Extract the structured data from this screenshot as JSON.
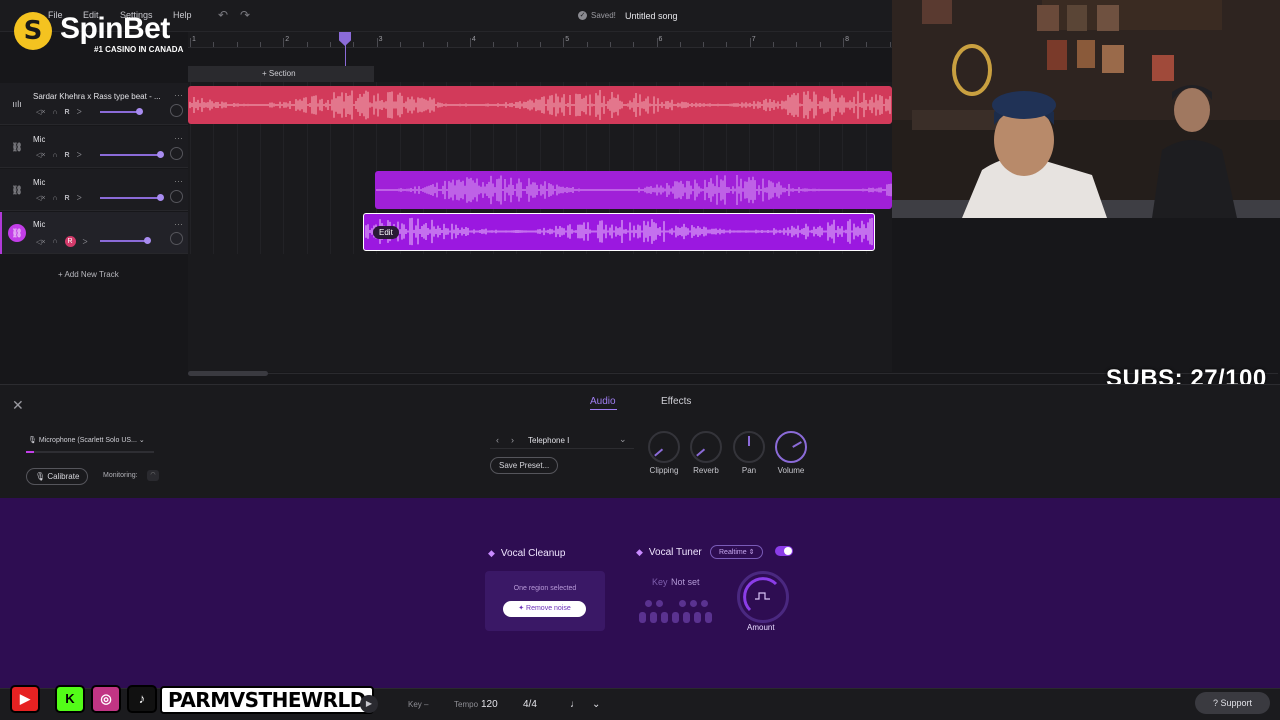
{
  "logo": {
    "name": "SpinBet",
    "tagline": "#1 CASINO IN CANADA",
    "glyph": "S"
  },
  "menu": [
    "File",
    "Edit",
    "Settings",
    "Help"
  ],
  "header": {
    "saved": "Saved!",
    "song_title": "Untitled song",
    "undo_icon": "undo-icon",
    "redo_icon": "redo-icon"
  },
  "ruler": {
    "numbers": [
      "1",
      "2",
      "3",
      "4",
      "5",
      "6",
      "7",
      "8"
    ]
  },
  "section": {
    "label": "+ Section"
  },
  "tracks": [
    {
      "name": "Sardar Khehra x Rass type beat - ...",
      "icon": "waveform-icon",
      "controls": [
        "◁×",
        "∩",
        "R",
        "ᐳ"
      ],
      "volume": 0.6,
      "color": "#d23a5a"
    },
    {
      "name": "Mic",
      "icon": "link-icon",
      "controls": [
        "◁×",
        "∩",
        "R",
        "ᐳ"
      ],
      "volume": 0.9
    },
    {
      "name": "Mic",
      "icon": "link-icon",
      "controls": [
        "◁×",
        "∩",
        "R",
        "ᐳ"
      ],
      "volume": 0.9,
      "color": "#a020d8"
    },
    {
      "name": "Mic",
      "icon": "link-icon",
      "controls": [
        "◁×",
        "∩",
        "R",
        "ᐳ"
      ],
      "volume": 0.75,
      "color": "#9b18e0",
      "selected": true
    }
  ],
  "clip": {
    "edit_label": "Edit"
  },
  "add_track": "+ Add New Track",
  "overlay": {
    "subs": "SUBS: 27/100"
  },
  "panel": {
    "close_icon": "close-icon",
    "tabs": [
      "Audio",
      "Effects"
    ],
    "active_tab": "Audio",
    "mic": "Microphone (Scarlett Solo US...",
    "calibrate": "Calibrate",
    "monitoring": "Monitoring:",
    "preset": "Telephone I",
    "save_preset": "Save Preset...",
    "effects": [
      "Clipping",
      "Reverb",
      "Pan",
      "Volume"
    ]
  },
  "vocal_cleanup": {
    "title": "Vocal Cleanup",
    "status": "One region selected",
    "button": "Remove noise"
  },
  "vocal_tuner": {
    "title": "Vocal Tuner",
    "mode": "Realtime",
    "key_label": "Key",
    "key_value": "Not set",
    "amount": "Amount",
    "enabled": true
  },
  "bottom": {
    "handle": "PARMVSTHEWRLD",
    "key_label": "Key",
    "key_value": "–",
    "tempo_label": "Tempo",
    "tempo_value": "120",
    "time_sig": "4/4",
    "support": "Support"
  },
  "colors": {
    "accent": "#8b6bd8",
    "beat_clip": "#d23a5a",
    "mic_clip": "#a020d8",
    "purple_panel": "#2e0d52"
  }
}
